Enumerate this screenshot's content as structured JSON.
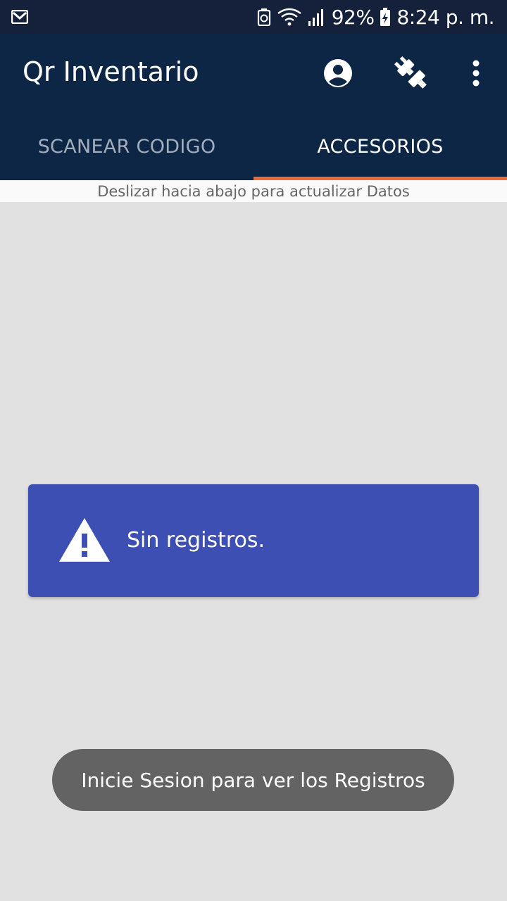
{
  "status_bar": {
    "notification_icon": "gmail-icon",
    "battery_percent": "92%",
    "time": "8:24 p. m."
  },
  "app_bar": {
    "title": "Qr Inventario",
    "icons": [
      "account-icon",
      "plug-icon",
      "more-vert-icon"
    ]
  },
  "tabs": [
    {
      "label": "SCANEAR CODIGO",
      "active": false
    },
    {
      "label": "ACCESORIOS",
      "active": true
    }
  ],
  "hint": "Deslizar hacia abajo para actualizar Datos",
  "empty_state": {
    "icon": "warning-icon",
    "message": "Sin registros."
  },
  "toast": "Inicie Sesion para ver los Registros",
  "colors": {
    "status_bar": "#15213a",
    "primary": "#0d2645",
    "tab_indicator": "#ee6a3c",
    "card": "#3e4fb4",
    "background": "#e1e1e1",
    "toast": "#636363"
  }
}
